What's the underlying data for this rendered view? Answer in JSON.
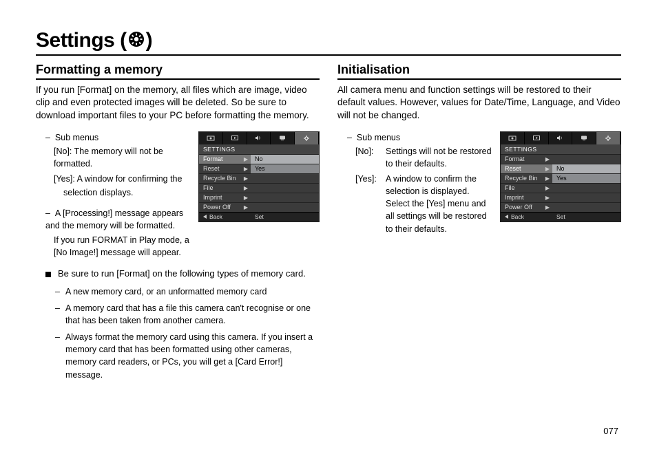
{
  "page_number": "077",
  "title_prefix": "Settings (",
  "title_suffix": ")",
  "left": {
    "heading": "Formatting a memory",
    "intro": "If you run [Format] on the memory, all files which are image, video clip and even protected images will be deleted. So be sure to download important files to your PC before formatting the memory.",
    "sub_label": "Sub menus",
    "sub_no": "[No]: The memory will not be formatted.",
    "sub_yes": "[Yes]: A window for confirming the selection displays.",
    "note1_a": "A [Processing!] message appears and the memory will be formatted.",
    "note1_b": "If you run FORMAT in Play mode, a [No Image!] message will appear.",
    "bullet_lead": "Be sure to run [Format] on the following types of memory card.",
    "d1": "A new memory card, or an unformatted memory card",
    "d2": "A memory card that has a file this camera can't recognise or one that has been taken from another camera.",
    "d3": "Always format the memory card using this camera. If you insert a memory card that has been formatted using other cameras, memory card readers, or PCs, you will get a [Card Error!] message.",
    "lcd": {
      "title": "SETTINGS",
      "rows": [
        "Format",
        "Reset",
        "Recycle Bin",
        "File",
        "Imprint",
        "Power Off"
      ],
      "hl_index": 0,
      "values": {
        "0": "No",
        "1": "Yes"
      },
      "back": "Back",
      "set": "Set"
    }
  },
  "right": {
    "heading": "Initialisation",
    "intro": "All camera menu and function settings will be restored to their default values. However, values for Date/Time, Language, and Video will not be changed.",
    "sub_label": "Sub menus",
    "no_label": "[No]:",
    "no_text": "Settings will not be restored to their defaults.",
    "yes_label": "[Yes]:",
    "yes_text": "A window to confirm the selection is displayed. Select the [Yes] menu and all settings will be restored to their defaults.",
    "lcd": {
      "title": "SETTINGS",
      "rows": [
        "Format",
        "Reset",
        "Recycle Bin",
        "File",
        "Imprint",
        "Power Off"
      ],
      "hl_index": 1,
      "values": {
        "1": "No",
        "2": "Yes"
      },
      "back": "Back",
      "set": "Set"
    }
  }
}
